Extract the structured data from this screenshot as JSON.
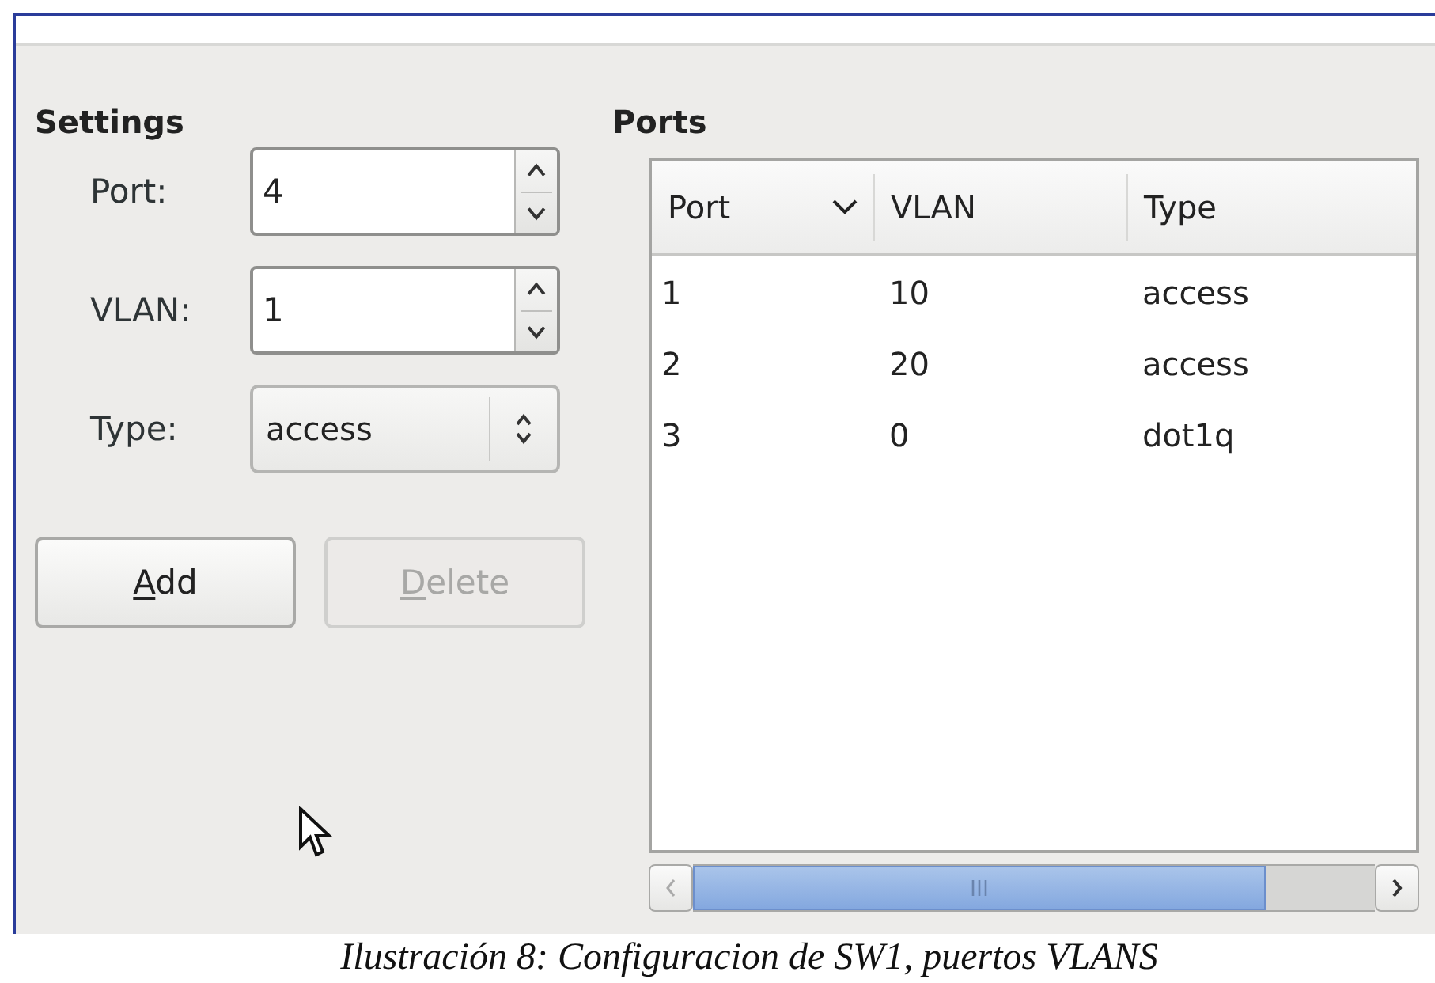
{
  "settings": {
    "title": "Settings",
    "fields": [
      {
        "label": "Port:",
        "value": "4",
        "kind": "spin"
      },
      {
        "label": "VLAN:",
        "value": "1",
        "kind": "spin"
      },
      {
        "label": "Type:",
        "value": "access",
        "kind": "combo"
      }
    ],
    "buttons": [
      {
        "label": "Add",
        "disabled": false,
        "underline_first": true
      },
      {
        "label": "Delete",
        "disabled": true,
        "underline_first": true
      }
    ]
  },
  "ports": {
    "title": "Ports",
    "columns": [
      {
        "label": "Port",
        "sorted": true
      },
      {
        "label": "VLAN",
        "sorted": false
      },
      {
        "label": "Type",
        "sorted": false
      }
    ],
    "rows": [
      [
        "1",
        "10",
        "access"
      ],
      [
        "2",
        "20",
        "access"
      ],
      [
        "3",
        "0",
        "dot1q"
      ]
    ]
  },
  "caption": "Ilustración 8: Configuracion de SW1, puertos VLANS"
}
